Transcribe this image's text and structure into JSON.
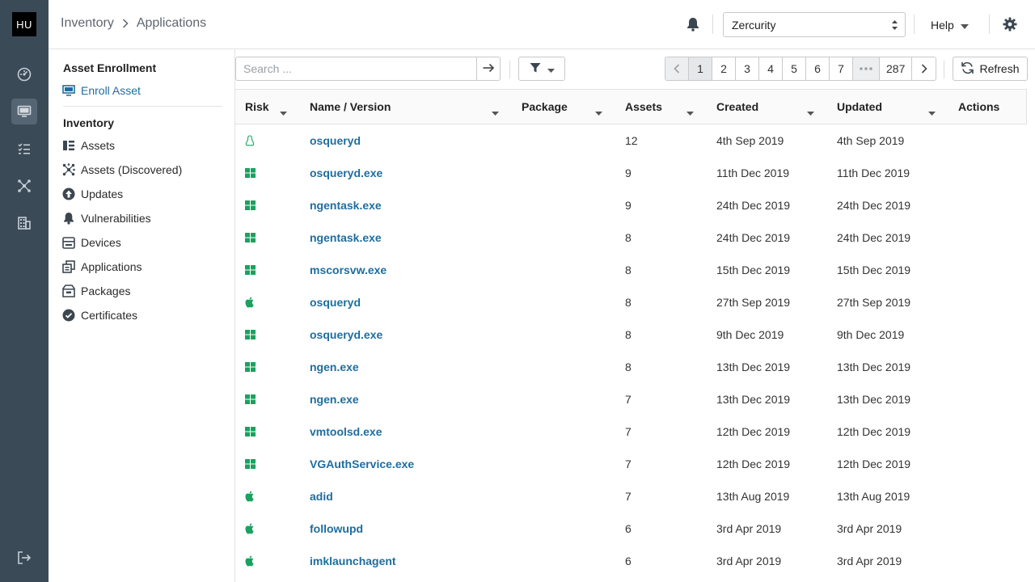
{
  "rail": {
    "logo": "HU"
  },
  "breadcrumb": {
    "parent": "Inventory",
    "current": "Applications"
  },
  "header": {
    "org": "Zercurity",
    "help": "Help"
  },
  "sidenav": {
    "enrollment_title": "Asset Enrollment",
    "enroll_link": "Enroll Asset",
    "inventory_title": "Inventory",
    "items": [
      {
        "label": "Assets",
        "icon": "assets-icon"
      },
      {
        "label": "Assets (Discovered)",
        "icon": "discovered-icon"
      },
      {
        "label": "Updates",
        "icon": "updates-icon"
      },
      {
        "label": "Vulnerabilities",
        "icon": "bell-icon"
      },
      {
        "label": "Devices",
        "icon": "devices-icon"
      },
      {
        "label": "Applications",
        "icon": "applications-icon"
      },
      {
        "label": "Packages",
        "icon": "packages-icon"
      },
      {
        "label": "Certificates",
        "icon": "certificates-icon"
      }
    ]
  },
  "toolbar": {
    "search_placeholder": "Search ...",
    "pages": [
      "1",
      "2",
      "3",
      "4",
      "5",
      "6",
      "7"
    ],
    "last_page": "287",
    "refresh": "Refresh"
  },
  "table": {
    "columns": {
      "risk": "Risk",
      "name": "Name / Version",
      "package": "Package",
      "assets": "Assets",
      "created": "Created",
      "updated": "Updated",
      "actions": "Actions"
    },
    "rows": [
      {
        "os": "linux",
        "name": "osqueryd",
        "package": "",
        "assets": "12",
        "created": "4th Sep 2019",
        "updated": "4th Sep 2019"
      },
      {
        "os": "windows",
        "name": "osqueryd.exe",
        "package": "",
        "assets": "9",
        "created": "11th Dec 2019",
        "updated": "11th Dec 2019"
      },
      {
        "os": "windows",
        "name": "ngentask.exe",
        "package": "",
        "assets": "9",
        "created": "24th Dec 2019",
        "updated": "24th Dec 2019"
      },
      {
        "os": "windows",
        "name": "ngentask.exe",
        "package": "",
        "assets": "8",
        "created": "24th Dec 2019",
        "updated": "24th Dec 2019"
      },
      {
        "os": "windows",
        "name": "mscorsvw.exe",
        "package": "",
        "assets": "8",
        "created": "15th Dec 2019",
        "updated": "15th Dec 2019"
      },
      {
        "os": "apple",
        "name": "osqueryd",
        "package": "",
        "assets": "8",
        "created": "27th Sep 2019",
        "updated": "27th Sep 2019"
      },
      {
        "os": "windows",
        "name": "osqueryd.exe",
        "package": "",
        "assets": "8",
        "created": "9th Dec 2019",
        "updated": "9th Dec 2019"
      },
      {
        "os": "windows",
        "name": "ngen.exe",
        "package": "",
        "assets": "8",
        "created": "13th Dec 2019",
        "updated": "13th Dec 2019"
      },
      {
        "os": "windows",
        "name": "ngen.exe",
        "package": "",
        "assets": "7",
        "created": "13th Dec 2019",
        "updated": "13th Dec 2019"
      },
      {
        "os": "windows",
        "name": "vmtoolsd.exe",
        "package": "",
        "assets": "7",
        "created": "12th Dec 2019",
        "updated": "12th Dec 2019"
      },
      {
        "os": "windows",
        "name": "VGAuthService.exe",
        "package": "",
        "assets": "7",
        "created": "12th Dec 2019",
        "updated": "12th Dec 2019"
      },
      {
        "os": "apple",
        "name": "adid",
        "package": "",
        "assets": "7",
        "created": "13th Aug 2019",
        "updated": "13th Aug 2019"
      },
      {
        "os": "apple",
        "name": "followupd",
        "package": "",
        "assets": "6",
        "created": "3rd Apr 2019",
        "updated": "3rd Apr 2019"
      },
      {
        "os": "apple",
        "name": "imklaunchagent",
        "package": "",
        "assets": "6",
        "created": "3rd Apr 2019",
        "updated": "3rd Apr 2019"
      }
    ]
  },
  "colors": {
    "rail": "#3b4a57",
    "link": "#1f6d9e",
    "os_icon": "#1aa260"
  }
}
